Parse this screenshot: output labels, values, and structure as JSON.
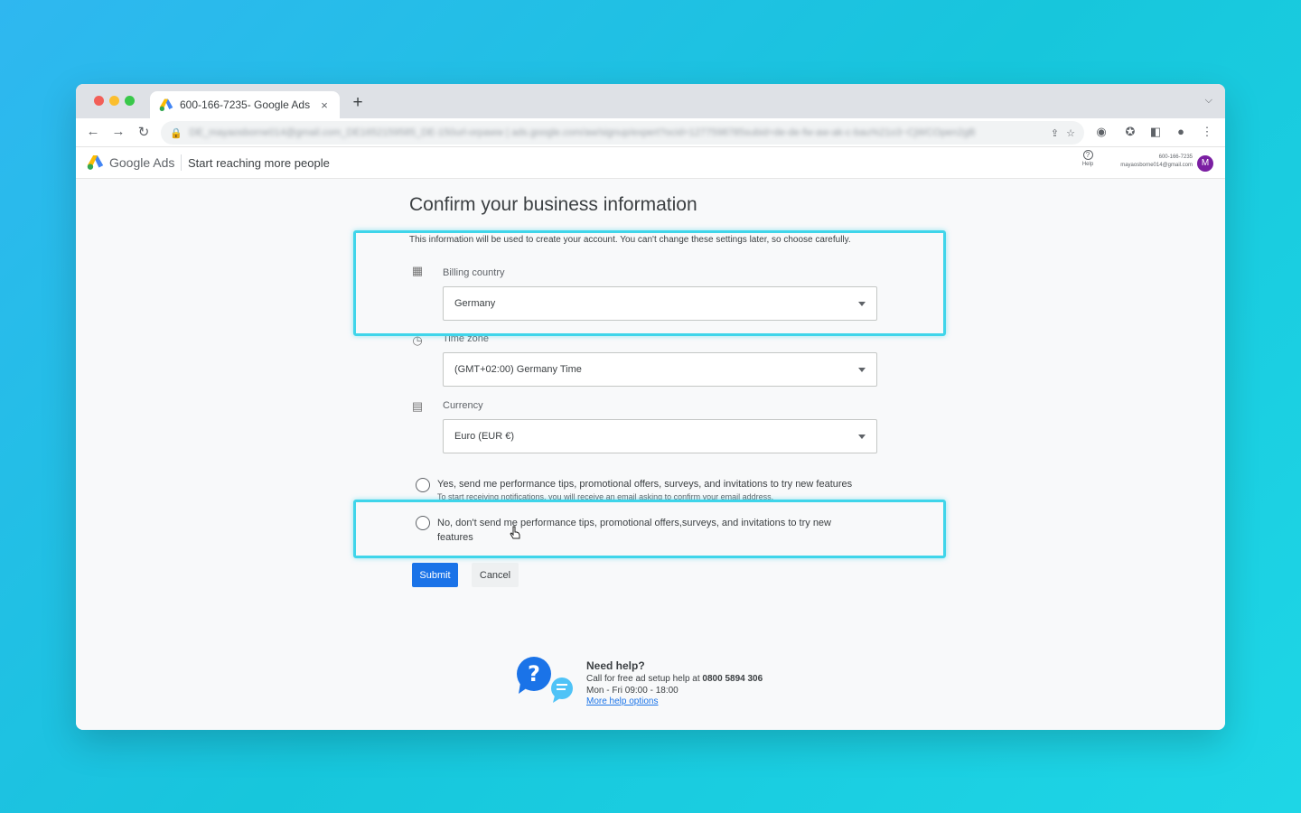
{
  "colors": {
    "accent": "#1a73e8",
    "highlight": "#3fd5ea",
    "avatar": "#7b1fa2"
  },
  "browser": {
    "tab_title": "600-166-7235- Google Ads",
    "tab_close": "×",
    "new_tab": "+",
    "url": "DE_mayaosborne014@gmail.com_DE1652159585_DE-150url-orpaww | ads.google.com/aw/signup/expert?ocid=1277598785subid=de-de-fw-aw-ak-c-bau%21o3~CjWCOpen2gB"
  },
  "app": {
    "brand": "Google Ads",
    "tagline": "Start reaching more people",
    "help_label": "Help",
    "account_id": "600-166-7235",
    "account_email": "mayaosborne014@gmail.com",
    "avatar_initial": "M"
  },
  "form": {
    "title": "Confirm your business information",
    "intro": "This information will be used to create your account. You can't change these settings later, so choose carefully.",
    "billing_country": {
      "label": "Billing country",
      "value": "Germany"
    },
    "time_zone": {
      "label": "Time zone",
      "value": "(GMT+02:00) Germany Time"
    },
    "currency": {
      "label": "Currency",
      "value": "Euro (EUR €)"
    },
    "opt_in": {
      "label": "Yes, send me performance tips, promotional offers, surveys, and invitations to try new features",
      "sub": "To start receiving notifications, you will receive an email asking to confirm your email address."
    },
    "opt_out": {
      "label_line1": "No, don't send me performance tips, promotional offers,surveys, and invitations to try new",
      "label_line2": "features"
    },
    "submit": "Submit",
    "cancel": "Cancel"
  },
  "help": {
    "heading": "Need help?",
    "call_prefix": "Call for free ad setup help at ",
    "phone": "0800 5894 306",
    "hours": "Mon - Fri 09:00 - 18:00",
    "more": "More help options"
  }
}
